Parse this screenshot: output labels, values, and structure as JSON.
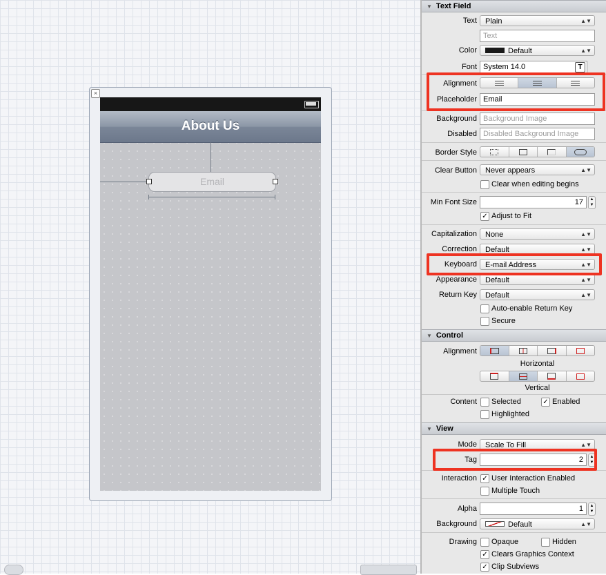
{
  "canvas": {
    "nav_title": "About Us",
    "text_field_placeholder": "Email",
    "close_glyph": "×"
  },
  "inspector": {
    "text_field_section": "Text Field",
    "text_label": "Text",
    "text_value": "Plain",
    "text_placeholder": "Text",
    "color_label": "Color",
    "color_value": "Default",
    "color_swatch": "#1a1a1a",
    "font_label": "Font",
    "font_value": "System 14.0",
    "font_btn": "T",
    "alignment_label": "Alignment",
    "alignment_options": [
      "left",
      "center",
      "right"
    ],
    "alignment_selected": "center",
    "placeholder_label": "Placeholder",
    "placeholder_value": "Email",
    "background_label": "Background",
    "background_placeholder": "Background Image",
    "disabled_label": "Disabled",
    "disabled_placeholder": "Disabled Background Image",
    "border_style_label": "Border Style",
    "border_style_selected": "rounded",
    "clear_button_label": "Clear Button",
    "clear_button_value": "Never appears",
    "clear_editing_label": "Clear when editing begins",
    "clear_editing_checked": false,
    "min_font_label": "Min Font Size",
    "min_font_value": "17",
    "adjust_fit_label": "Adjust to Fit",
    "adjust_fit_checked": true,
    "capitalization_label": "Capitalization",
    "capitalization_value": "None",
    "correction_label": "Correction",
    "correction_value": "Default",
    "keyboard_label": "Keyboard",
    "keyboard_value": "E-mail Address",
    "appearance_label": "Appearance",
    "appearance_value": "Default",
    "return_key_label": "Return Key",
    "return_key_value": "Default",
    "auto_enable_label": "Auto-enable Return Key",
    "auto_enable_checked": false,
    "secure_label": "Secure",
    "secure_checked": false,
    "control_section": "Control",
    "ctrl_alignment_label": "Alignment",
    "horizontal_label": "Horizontal",
    "vertical_label": "Vertical",
    "content_label": "Content",
    "selected_label": "Selected",
    "selected_checked": false,
    "enabled_label": "Enabled",
    "enabled_checked": true,
    "highlighted_label": "Highlighted",
    "highlighted_checked": false,
    "view_section": "View",
    "mode_label": "Mode",
    "mode_value": "Scale To Fill",
    "tag_label": "Tag",
    "tag_value": "2",
    "interaction_label": "Interaction",
    "user_interaction_label": "User Interaction Enabled",
    "user_interaction_checked": true,
    "multiple_touch_label": "Multiple Touch",
    "multiple_touch_checked": false,
    "alpha_label": "Alpha",
    "alpha_value": "1",
    "view_background_label": "Background",
    "view_background_value": "Default",
    "drawing_label": "Drawing",
    "opaque_label": "Opaque",
    "opaque_checked": false,
    "hidden_label": "Hidden",
    "hidden_checked": false,
    "clears_label": "Clears Graphics Context",
    "clears_checked": true,
    "clip_label": "Clip Subviews",
    "clip_checked": true,
    "check_glyph": "✓",
    "arrow_glyph": "▲▼"
  },
  "highlight_color": "#ee3322"
}
